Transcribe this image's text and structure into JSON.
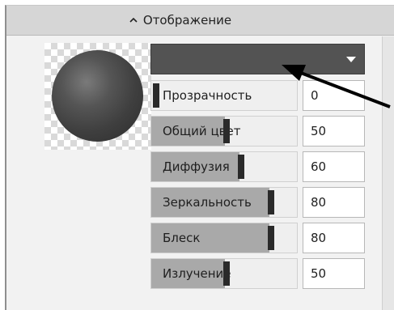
{
  "panel": {
    "title": "Отображение",
    "collapse_icon": "chevron-up-icon"
  },
  "material": {
    "color": "#535353",
    "preview_icon": "sphere-preview"
  },
  "sliders": [
    {
      "label": "Прозрачность",
      "value": "0",
      "fraction": 0.0
    },
    {
      "label": "Общий цвет",
      "value": "50",
      "fraction": 0.5
    },
    {
      "label": "Диффузия",
      "value": "60",
      "fraction": 0.6
    },
    {
      "label": "Зеркальность",
      "value": "80",
      "fraction": 0.8
    },
    {
      "label": "Блеск",
      "value": "80",
      "fraction": 0.8
    },
    {
      "label": "Излучение",
      "value": "50",
      "fraction": 0.5
    }
  ],
  "annotation": {
    "icon": "pointer-arrow",
    "color": "#000000"
  }
}
